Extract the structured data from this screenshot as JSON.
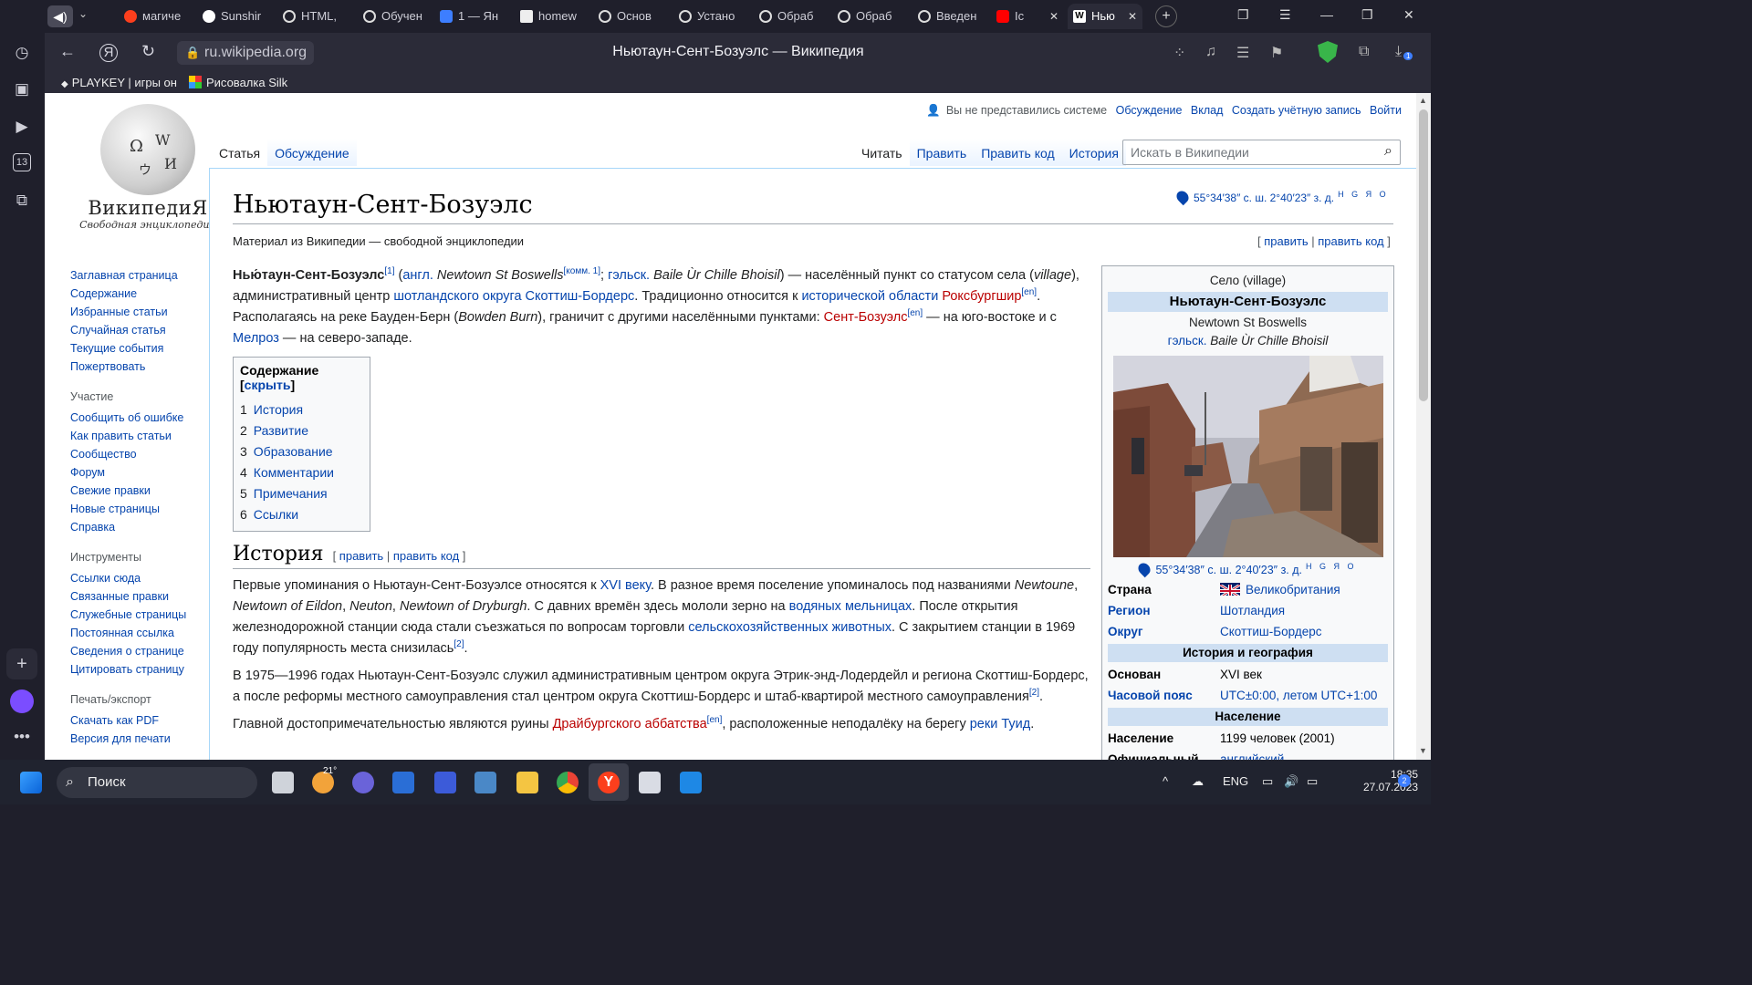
{
  "browser": {
    "tabs": [
      "магиче",
      "Sunshir",
      "HTML,",
      "Обучен",
      "1 — Ян",
      "homew",
      "Основ",
      "Устано",
      "Обраб",
      "Обраб",
      "Введен",
      "Ic",
      "Нью"
    ],
    "url": "ru.wikipedia.org",
    "page_title": "Ньютаун-Сент-Бозуэлс — Википедия",
    "bookmarks": [
      "PLAYKEY | игры он",
      "Рисовалка Silk"
    ],
    "downloads_badge": "1",
    "rail_calendar": "13"
  },
  "wiki": {
    "logo_title": "ВикипедиЯ",
    "logo_subtitle": "Свободная энциклопедия",
    "nav_main": [
      "Заглавная страница",
      "Содержание",
      "Избранные статьи",
      "Случайная статья",
      "Текущие события",
      "Пожертвовать"
    ],
    "nav_participation_header": "Участие",
    "nav_participation": [
      "Сообщить об ошибке",
      "Как править статьи",
      "Сообщество",
      "Форум",
      "Свежие правки",
      "Новые страницы",
      "Справка"
    ],
    "nav_tools_header": "Инструменты",
    "nav_tools": [
      "Ссылки сюда",
      "Связанные правки",
      "Служебные страницы",
      "Постоянная ссылка",
      "Сведения о странице",
      "Цитировать страницу"
    ],
    "nav_print_header": "Печать/экспорт",
    "nav_print": [
      "Скачать как PDF",
      "Версия для печати"
    ],
    "personal": {
      "not_logged": "Вы не представились системе",
      "talk": "Обсуждение",
      "contrib": "Вклад",
      "create": "Создать учётную запись",
      "login": "Войти"
    },
    "tabs": {
      "article": "Статья",
      "discussion": "Обсуждение",
      "read": "Читать",
      "edit": "Править",
      "edit_source": "Править код",
      "history": "История"
    },
    "search_placeholder": "Искать в Википедии",
    "title": "Ньютаун-Сент-Бозуэлс",
    "coords": "55°34′38″ с. ш. 2°40′23″ з. д.",
    "coords_sup": "H G Я O",
    "tagline": "Материал из Википедии — свободной энциклопедии",
    "edit_links": {
      "edit": "править",
      "edit_source": "править код"
    },
    "toc": {
      "title": "Содержание",
      "hide": "скрыть",
      "items": [
        {
          "num": "1",
          "label": "История"
        },
        {
          "num": "2",
          "label": "Развитие"
        },
        {
          "num": "3",
          "label": "Образование"
        },
        {
          "num": "4",
          "label": "Комментарии"
        },
        {
          "num": "5",
          "label": "Примечания"
        },
        {
          "num": "6",
          "label": "Ссылки"
        }
      ]
    },
    "section_history": "История",
    "infobox": {
      "type": "Село (village)",
      "name": "Ньютаун-Сент-Бозуэлс",
      "english_name": "Newtown St Boswells",
      "gaelic_label": "гэльск.",
      "gaelic_name": "Baile Ùr Chille Bhoisil",
      "coords": "55°34′38″ с. ш. 2°40′23″ з. д.",
      "coords_sup": "H G Я O",
      "country_k": "Страна",
      "country_v": "Великобритания",
      "region_k": "Регион",
      "region_v": "Шотландия",
      "district_k": "Округ",
      "district_v": "Скоттиш-Бордерс",
      "history_header": "История и география",
      "founded_k": "Основан",
      "founded_v": "XVI век",
      "tz_k": "Часовой пояс",
      "tz_v": "UTC±0:00, летом UTC+1:00",
      "pop_header": "Население",
      "pop_k": "Население",
      "pop_v": "1199 человек (2001)",
      "lang_k": "Официальный",
      "lang_v": "английский"
    }
  },
  "taskbar": {
    "search": "Поиск",
    "weather": "21°",
    "lang": "ENG",
    "time": "18:35",
    "date": "27.07.2023",
    "notif": "2"
  },
  "colors": {
    "link": "#0645ad",
    "redlink": "#ba0000",
    "chrome": "#1f1f2b"
  }
}
